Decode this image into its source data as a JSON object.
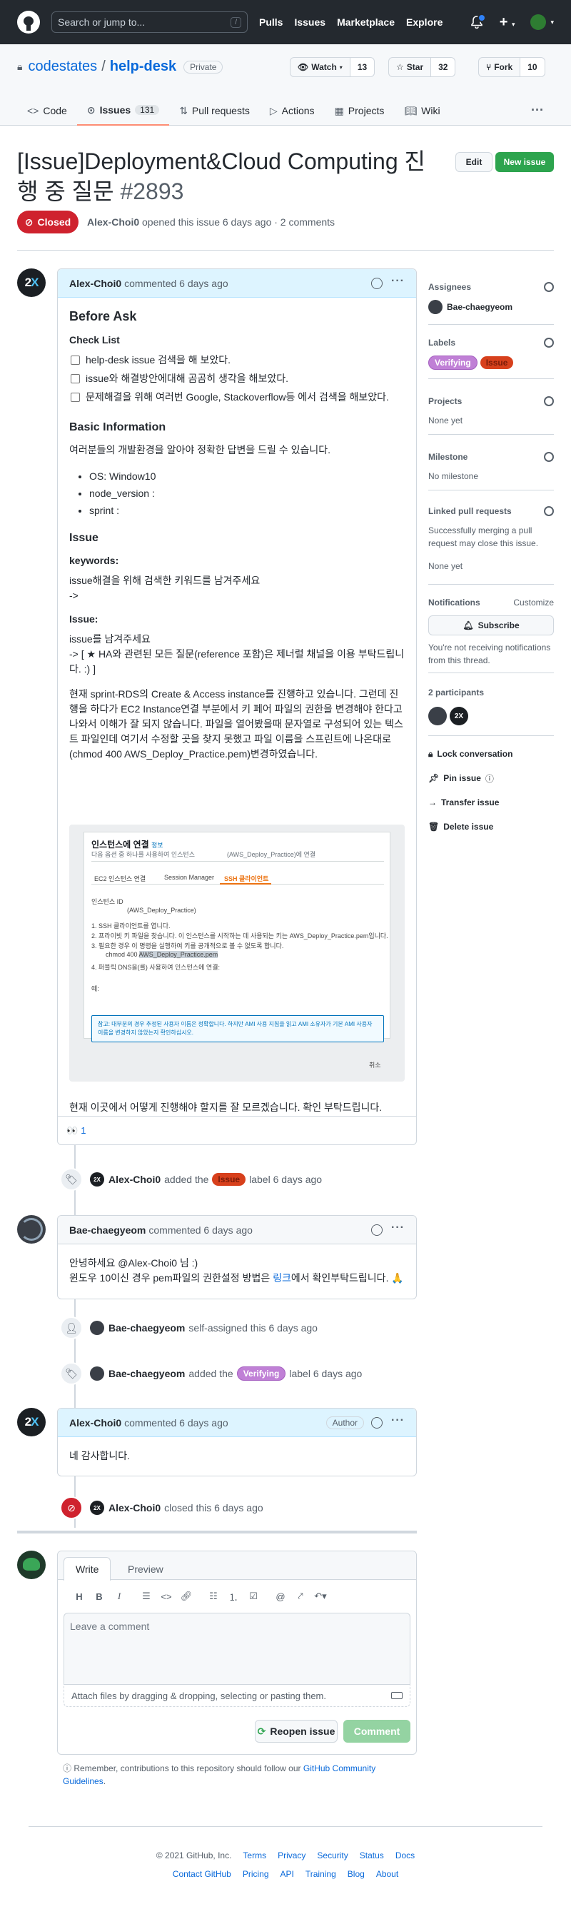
{
  "header": {
    "search_placeholder": "Search or jump to...",
    "slash_key": "/",
    "nav": [
      "Pulls",
      "Issues",
      "Marketplace",
      "Explore"
    ]
  },
  "repo": {
    "owner": "codestates",
    "name": "help-desk",
    "visibility": "Private",
    "watch_label": "Watch",
    "watch_count": "13",
    "star_label": "Star",
    "star_count": "32",
    "fork_label": "Fork",
    "fork_count": "10",
    "tabs": [
      {
        "label": "Code"
      },
      {
        "label": "Issues",
        "count": "131"
      },
      {
        "label": "Pull requests"
      },
      {
        "label": "Actions"
      },
      {
        "label": "Projects"
      },
      {
        "label": "Wiki"
      }
    ]
  },
  "issue": {
    "title": "[Issue]Deployment&Cloud Computing 진행 중 질문",
    "number": "#2893",
    "edit_label": "Edit",
    "new_issue_label": "New issue",
    "state": "Closed",
    "author": "Alex-Choi0",
    "opened_text": "opened this issue 6 days ago · 2 comments"
  },
  "comment1": {
    "author": "Alex-Choi0",
    "time": "commented 6 days ago",
    "h_before": "Before Ask",
    "h_checklist": "Check List",
    "checks": [
      "help-desk issue 검색을 해 보았다.",
      "issue와 해결방안에대해 곰곰히 생각을 해보았다.",
      "문제해결을 위해 여러번 Google, Stackoverflow등 에서 검색을 해보았다."
    ],
    "h_basic": "Basic Information",
    "basic_intro": "여러분들의 개발환경을 알아야 정확한 답변을 드릴 수 있습니다.",
    "basic_items": [
      "OS: Window10",
      "node_version :",
      "sprint :"
    ],
    "h_issue": "Issue",
    "h_keywords": "keywords:",
    "keywords_text": "issue해결을 위해 검색한 키워드를 남겨주세요",
    "keywords_arrow": "->",
    "h_issue2": "Issue:",
    "issue_line1": "issue를 남겨주세요",
    "issue_line2": "-> [ ★ HA와 관련된 모든 질문(reference 포함)은 제너럴 채널을 이용 부탁드립니다. :) ]",
    "body_para": "현재 sprint-RDS의 Create & Access instance를 진행하고 있습니다. 그런데 진행을 하다가 EC2 Instance연결 부분에서 키 페어 파일의 권한을 변경해야 한다고 나와서 이해가 잘 되지 않습니다. 파일을 열어봤을때 문자열로 구성되어 있는 텍스트 파일인데 여기서 수정할 곳을 찾지 못했고 파일 이름을 스프린트에 나온대로(chmod 400 AWS_Deploy_Practice.pem)변경하였습니다.",
    "closing": "현재 이곳에서 어떻게 진행해야 할지를 잘 모르겠습니다. 확인 부탁드립니다.",
    "reaction_emoji": "👀",
    "reaction_count": "1"
  },
  "screenshot": {
    "title": "인스턴스에 연결",
    "info_link": "정보",
    "subtitle": "다음 옵션 중 하나를 사용하여 인스턴스",
    "instance_hint": "(AWS_Deploy_Practice)에 연결",
    "tab1": "EC2 인스턴스 연결",
    "tab2": "Session Manager",
    "tab3": "SSH 클라이언트",
    "id_label": "인스턴스 ID",
    "id_value": "(AWS_Deploy_Practice)",
    "step1": "1. SSH 클라이언트를 엽니다.",
    "step2": "2. 프라이빗 키 파일을 찾습니다. 이 인스턴스를 시작하는 데 사용되는 키는 AWS_Deploy_Practice.pem입니다.",
    "step3": "3. 필요한 경우 이 명령을 실행하여 키를 공개적으로 볼 수 없도록 합니다.",
    "cmd": "chmod 400",
    "cmd_file": "AWS_Deploy_Practice.pem",
    "step4": "4. 퍼블릭 DNS을(를) 사용하여 인스턴스에 연결:",
    "example": "예:",
    "note": "참고: 대부분의 경우 추정된 사용자 이름은 정확합니다. 하지만 AMI 사용 지침을 읽고 AMI 소유자가 기본 AMI 사용자 이름을 변경하지 않았는지 확인하십시오.",
    "cancel": "취소"
  },
  "event_label1": {
    "user": "Alex-Choi0",
    "pre": "added the",
    "label": "Issue",
    "post": "label 6 days ago"
  },
  "comment2": {
    "author": "Bae-chaegyeom",
    "time": "commented 6 days ago",
    "line1": "안녕하세요 @Alex-Choi0 님 :)",
    "line2a": "윈도우 10이신 경우 pem파일의 권한설정 방법은",
    "line2link": "링크",
    "line2b": "에서 확인부탁드립니다. 🙏"
  },
  "event_assign": {
    "user": "Bae-chaegyeom",
    "text": "self-assigned this 6 days ago"
  },
  "event_label2": {
    "user": "Bae-chaegyeom",
    "pre": "added the",
    "label": "Verifying",
    "post": "label 6 days ago"
  },
  "comment3": {
    "author": "Alex-Choi0",
    "time": "commented 6 days ago",
    "badge": "Author",
    "body": "네 감사합니다."
  },
  "event_close": {
    "user": "Alex-Choi0",
    "text": "closed this 6 days ago"
  },
  "editor": {
    "tab_write": "Write",
    "tab_preview": "Preview",
    "placeholder": "Leave a comment",
    "attach": "Attach files by dragging & dropping, selecting or pasting them.",
    "reopen": "Reopen issue",
    "comment": "Comment",
    "remember_pre": "Remember, contributions to this repository should follow our",
    "remember_link": "GitHub Community Guidelines",
    "remember_post": "."
  },
  "sidebar": {
    "assignees_h": "Assignees",
    "assignee": "Bae-chaegyeom",
    "labels_h": "Labels",
    "label1": "Verifying",
    "label2": "Issue",
    "projects_h": "Projects",
    "projects_v": "None yet",
    "milestone_h": "Milestone",
    "milestone_v": "No milestone",
    "linked_h": "Linked pull requests",
    "linked_desc": "Successfully merging a pull request may close this issue.",
    "linked_v": "None yet",
    "notif_h": "Notifications",
    "customize": "Customize",
    "subscribe": "Subscribe",
    "notif_desc": "You're not receiving notifications from this thread.",
    "participants_h": "2 participants",
    "lock": "Lock conversation",
    "pin": "Pin issue",
    "transfer": "Transfer issue",
    "delete": "Delete issue"
  },
  "footer": {
    "copyright": "© 2021 GitHub, Inc.",
    "row1": [
      "Terms",
      "Privacy",
      "Security",
      "Status",
      "Docs"
    ],
    "row2": [
      "Contact GitHub",
      "Pricing",
      "API",
      "Training",
      "Blog",
      "About"
    ]
  }
}
